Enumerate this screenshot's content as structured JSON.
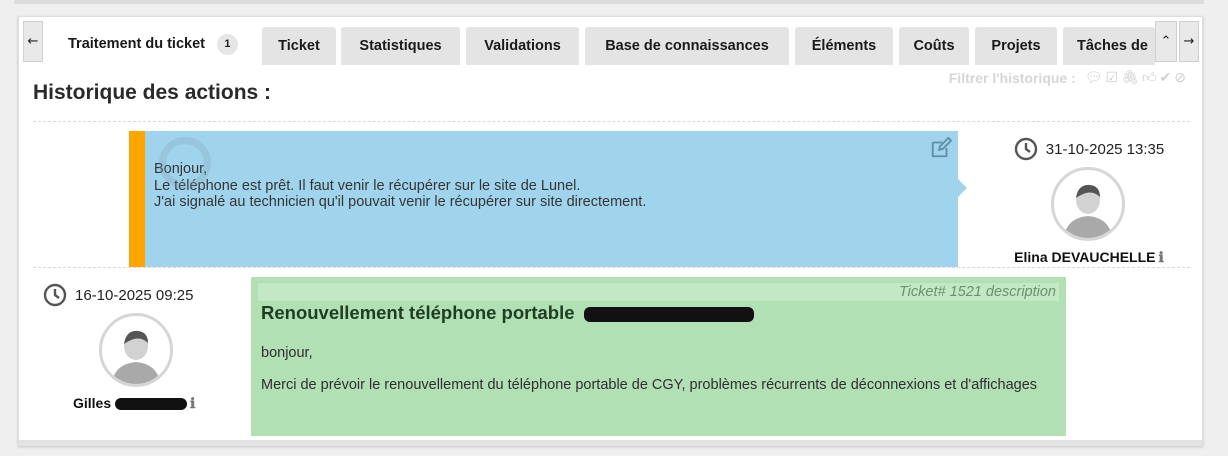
{
  "tabs": {
    "prev_arrow": "←",
    "next_arrow": "→",
    "collapse_arrow": "⌃",
    "items": [
      {
        "label": "Traitement du ticket",
        "badge": "1"
      },
      {
        "label": "Ticket"
      },
      {
        "label": "Statistiques"
      },
      {
        "label": "Validations"
      },
      {
        "label": "Base de connaissances"
      },
      {
        "label": "Éléments"
      },
      {
        "label": "Coûts"
      },
      {
        "label": "Projets"
      },
      {
        "label": "Tâches de"
      }
    ]
  },
  "filter": {
    "label": "Filtrer l'historique :",
    "icons": [
      "comment-icon",
      "task-icon",
      "document-icon",
      "validation-icon",
      "solution-icon",
      "refused-icon"
    ]
  },
  "history": {
    "title": "Historique des actions :",
    "followup": {
      "date": "31-10-2025 13:35",
      "author": "Elina DEVAUCHELLE",
      "lines": [
        "Bonjour,",
        "Le téléphone est prêt. Il faut venir le récupérer sur le site de Lunel.",
        "J'ai signalé au technicien qu'il pouvait venir le récupérer sur site directement."
      ],
      "accent_color": "#ffa500",
      "bg_color": "#a0d4ec"
    },
    "description": {
      "date": "16-10-2025 09:25",
      "author_first": "Gilles",
      "header": "Ticket# 1521 description",
      "title": "Renouvellement téléphone portable",
      "paragraphs": [
        "bonjour,",
        "Merci de prévoir le renouvellement du téléphone portable de CGY, problèmes récurrents de déconnexions et d'affichages"
      ],
      "bg_color": "#b0e0b4"
    }
  }
}
